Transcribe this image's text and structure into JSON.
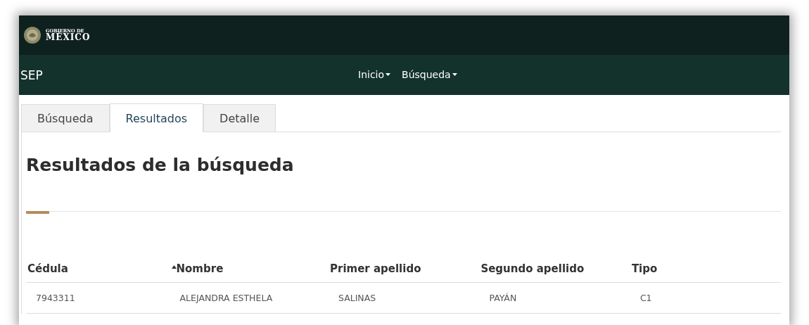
{
  "header": {
    "logo_line_1": "GOBIERNO DE",
    "logo_line_2": "MÉXICO"
  },
  "navbar": {
    "brand": "SEP",
    "items": [
      {
        "label": "Inicio",
        "dropdown": true
      },
      {
        "label": "Búsqueda",
        "dropdown": true
      }
    ]
  },
  "tabs": [
    {
      "label": "Búsqueda",
      "selected": false
    },
    {
      "label": "Resultados",
      "selected": true
    },
    {
      "label": "Detalle",
      "selected": false
    }
  ],
  "title": "Resultados de la búsqueda",
  "table": {
    "columns": [
      {
        "label": "Cédula",
        "sorted": false
      },
      {
        "label": "Nombre",
        "sorted": true
      },
      {
        "label": "Primer apellido",
        "sorted": false
      },
      {
        "label": "Segundo apellido",
        "sorted": false
      },
      {
        "label": "Tipo",
        "sorted": false
      }
    ],
    "rows": [
      [
        "7943311",
        "ALEJANDRA ESTHELA",
        "SALINAS",
        "PAYÁN",
        "C1"
      ]
    ]
  }
}
